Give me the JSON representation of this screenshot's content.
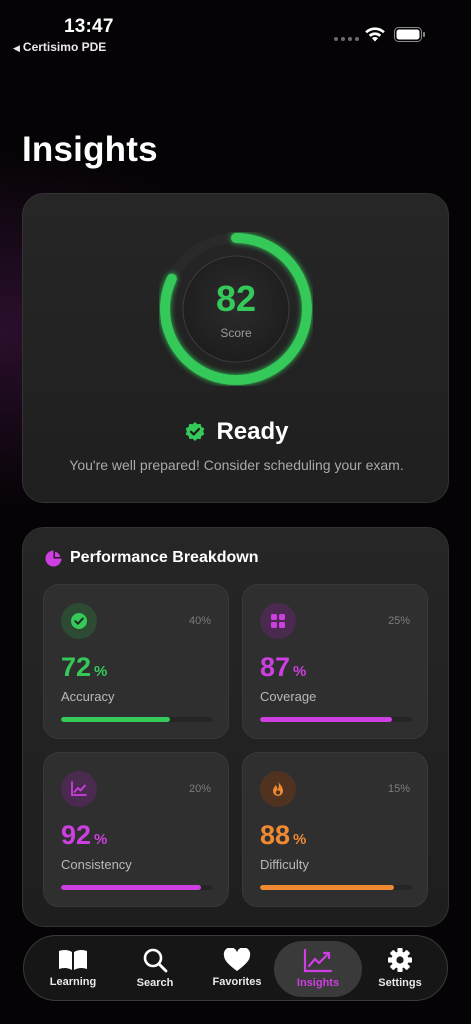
{
  "status_bar": {
    "time": "13:47",
    "back_app": "Certisimo PDE"
  },
  "page": {
    "title": "Insights"
  },
  "score": {
    "value": "82",
    "value_fraction": 0.82,
    "label": "Score",
    "status": "Ready",
    "message": "You're well prepared! Consider scheduling your exam."
  },
  "breakdown": {
    "title": "Performance Breakdown",
    "metrics": [
      {
        "name": "Accuracy",
        "value": "72",
        "unit": "%",
        "weight": "40%",
        "fill": 0.72,
        "color": "#35c95a",
        "icon": "checkmark-icon"
      },
      {
        "name": "Coverage",
        "value": "87",
        "unit": "%",
        "weight": "25%",
        "fill": 0.87,
        "color": "#cd3fe0",
        "icon": "grid-icon"
      },
      {
        "name": "Consistency",
        "value": "92",
        "unit": "%",
        "weight": "20%",
        "fill": 0.92,
        "color": "#cd3fe0",
        "icon": "chart-line-icon"
      },
      {
        "name": "Difficulty",
        "value": "88",
        "unit": "%",
        "weight": "15%",
        "fill": 0.88,
        "color": "#f08a32",
        "icon": "flame-icon"
      }
    ]
  },
  "tabs": [
    {
      "label": "Learning",
      "icon": "book-icon"
    },
    {
      "label": "Search",
      "icon": "search-icon"
    },
    {
      "label": "Favorites",
      "icon": "heart-icon"
    },
    {
      "label": "Insights",
      "icon": "chart-icon",
      "active": true
    },
    {
      "label": "Settings",
      "icon": "gear-icon"
    }
  ],
  "colors": {
    "accent": "#cd3fe0",
    "success": "#35c95a",
    "warning": "#f08a32"
  }
}
